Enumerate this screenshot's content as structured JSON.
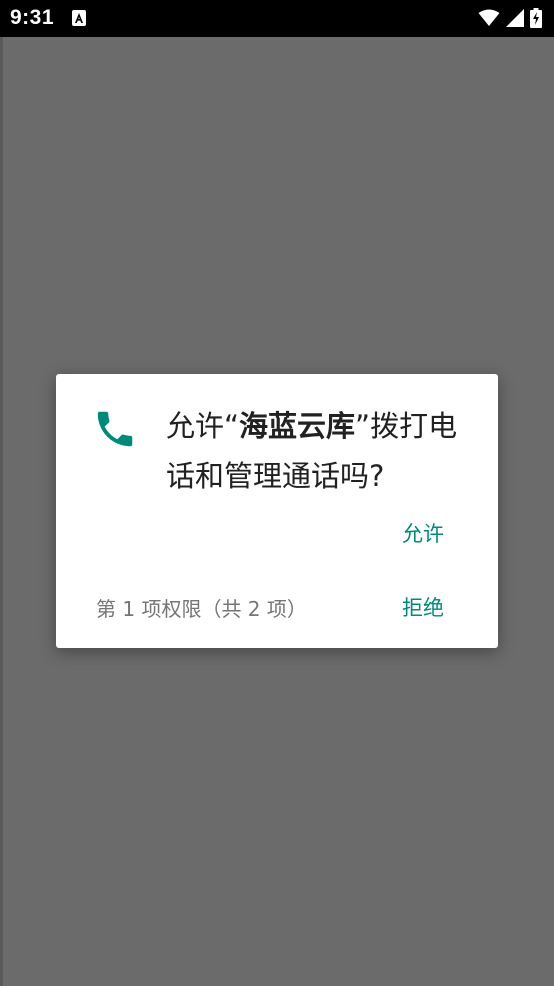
{
  "status_bar": {
    "time": "9:31",
    "icons": [
      "notification-a-icon",
      "wifi-icon",
      "signal-icon",
      "battery-charging-icon"
    ]
  },
  "dialog": {
    "message_prefix": "允许“",
    "app_name": "海蓝云库",
    "message_suffix": "”拨打电话和管理通话吗?",
    "allow_label": "允许",
    "deny_label": "拒绝",
    "permission_count": "第 1 项权限（共 2 项）",
    "icon": "phone-icon"
  },
  "colors": {
    "scrim": "#6b6b6b",
    "accent": "#00897b",
    "status_bar": "#000000"
  }
}
